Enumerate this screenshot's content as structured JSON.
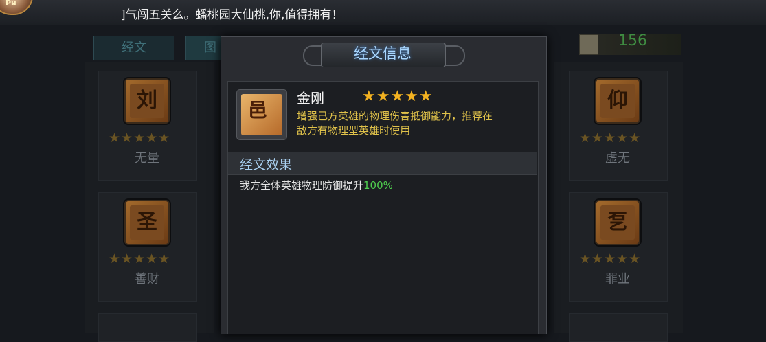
{
  "top": {
    "marquee": "]气闯五关么。蟠桃园大仙桃,你,值得拥有！",
    "avatar_tag": "Ри"
  },
  "tabs": [
    {
      "label": "经文"
    },
    {
      "label": "图"
    }
  ],
  "currency": {
    "icon": "scroll-icon",
    "value": "156"
  },
  "left_cards": [
    {
      "name": "无量",
      "stars": "★★★★★",
      "glyph": "刘"
    },
    {
      "name": "善财",
      "stars": "★★★★★",
      "glyph": "圣"
    }
  ],
  "right_cards": [
    {
      "name": "虚无",
      "stars": "★★★★★",
      "glyph": "仰"
    },
    {
      "name": "罪业",
      "stars": "★★★★★",
      "glyph": "乭"
    }
  ],
  "dialog": {
    "title": "经文信息",
    "item_name": "金刚",
    "item_stars": "★★★★★",
    "item_glyph": "邑",
    "description_line1": "增强己方英雄的物理伤害抵御能力，推荐在",
    "description_line2": "敌方有物理型英雄时使用",
    "section_title": "经文效果",
    "effect_text": "我方全体英雄物理防御提升",
    "effect_value": "100%"
  },
  "colors": {
    "star_gold": "#f3b221",
    "desc_yellow": "#e0c24a",
    "effect_green": "#4fcf4f",
    "title_blue": "#a9d7ff"
  }
}
